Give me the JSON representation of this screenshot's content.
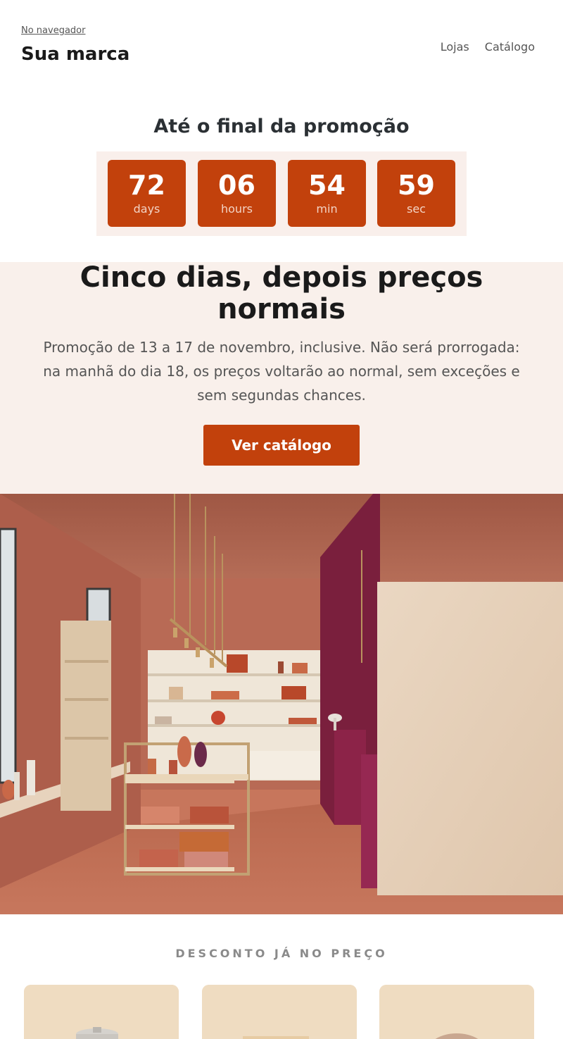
{
  "header": {
    "browser_link": "No navegador",
    "brand": "Sua marca",
    "nav": [
      "Lojas",
      "Catálogo"
    ]
  },
  "countdown": {
    "title": "Até o final da promoção",
    "units": [
      {
        "value": "72",
        "label": "days"
      },
      {
        "value": "06",
        "label": "hours"
      },
      {
        "value": "54",
        "label": "min"
      },
      {
        "value": "59",
        "label": "sec"
      }
    ]
  },
  "hero": {
    "title": "Cinco dias, depois preços normais",
    "description": "Promoção de 13 a 17 de novembro, inclusive. Não será prorrogada: na manhã do dia 18, os preços voltarão ao normal, sem exceções e sem segundas chances.",
    "cta": "Ver catálogo"
  },
  "discount": {
    "label": "DESCONTO JÁ NO PREÇO"
  },
  "colors": {
    "accent": "#c2410c",
    "hero_bg": "#f9f0eb",
    "timer_bg": "#f9efeb"
  }
}
